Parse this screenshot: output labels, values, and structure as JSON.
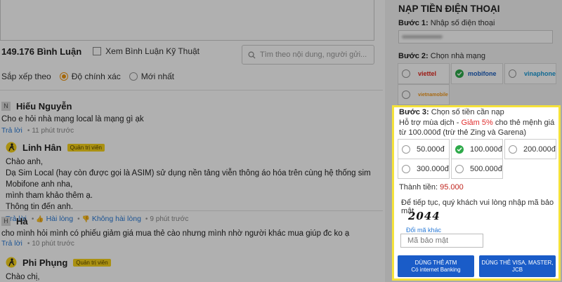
{
  "comments_section": {
    "count_label": "149.176 Bình Luận",
    "tech_filter_label": "Xem Bình Luận Kỹ Thuật",
    "search_placeholder": "Tìm theo nội dung, người gửi...",
    "sort_label": "Sắp xếp theo",
    "sort_options": [
      {
        "label": "Độ chính xác",
        "selected": true
      },
      {
        "label": "Mới nhất",
        "selected": false
      }
    ],
    "comments": [
      {
        "avatar": "N",
        "name": "Hiếu Nguyễn",
        "body": "Cho e hỏi nhà mạng local là mạng gì ạk",
        "reply": "Trả lời",
        "time": "11 phút trước"
      },
      {
        "name": "Linh Hân",
        "badge": "Quản trị viên",
        "lines": [
          "Chào anh,",
          "Dạ Sim Local (hay còn được gọi là ASIM) sử dụng nền tảng viễn thông áo hóa trên cùng hệ thống sim Mobifone anh nha,",
          "mình tham khảo thêm ạ.",
          "Thông tin đến anh."
        ],
        "reply": "Trả lời",
        "like": "Hài lòng",
        "dislike": "Không hài lòng",
        "time": "9 phút trước"
      },
      {
        "avatar": "H",
        "name": "Hà",
        "body": "cho mình hỏi mình có phiếu giảm giá mua thẻ cào nhưng mình nhờ người khác mua giúp đc ko ạ",
        "reply": "Trả lời",
        "time": "10 phút trước"
      },
      {
        "name": "Phi Phụng",
        "badge": "Quản trị viên",
        "lines": [
          "Chào chị,"
        ]
      }
    ]
  },
  "topup": {
    "title": "NẠP TIỀN ĐIỆN THOẠI",
    "step1_label": "Bước 1:",
    "step1_text": "Nhập số điện thoại",
    "step2_label": "Bước 2:",
    "step2_text": "Chọn nhà mạng",
    "networks": [
      {
        "name": "viettel",
        "selected": false,
        "color": "#e3261d"
      },
      {
        "name": "mobifone",
        "selected": true,
        "color": "#1b5fbf"
      },
      {
        "name": "vinaphone",
        "selected": false,
        "color": "#1a9ad6"
      },
      {
        "name": "vietnamobile",
        "selected": false,
        "color": "#f39a1e"
      }
    ],
    "step3_label": "Bước 3:",
    "step3_text": "Chọn số tiền cần nạp",
    "promo_prefix": "Hỗ trợ mùa dịch - ",
    "promo_highlight": "Giảm 5%",
    "promo_suffix": " cho thẻ mệnh giá từ 100.000đ (trừ thẻ Zing và Garena)",
    "amounts": [
      {
        "label": "50.000đ",
        "selected": false
      },
      {
        "label": "100.000đ",
        "selected": true
      },
      {
        "label": "200.000đ",
        "selected": false
      },
      {
        "label": "300.000đ",
        "selected": false
      },
      {
        "label": "500.000đ",
        "selected": false
      }
    ],
    "total_label": "Thành tiền:",
    "total_value": "95.000",
    "captcha_note": "Để tiếp tục, quý khách vui lòng nhập mã bảo mật",
    "captcha_code": "2044",
    "captcha_refresh": "Đổi mã khác",
    "captcha_placeholder": "Mã bảo mật",
    "btn_atm_line1": "DÙNG THẺ ATM",
    "btn_atm_line2": "Có internet Banking",
    "btn_visa_line1": "DÙNG THẺ VISA, MASTER,",
    "btn_visa_line2": "JCB"
  },
  "colors": {
    "highlight_border": "#f5e23a",
    "accent_blue": "#1a5cc8",
    "link_blue": "#2a7ad6",
    "discount_red": "#e02d2d",
    "check_green": "#2eaa4a",
    "sort_orange": "#f0960e",
    "staff_badge": "#f6d21b"
  }
}
